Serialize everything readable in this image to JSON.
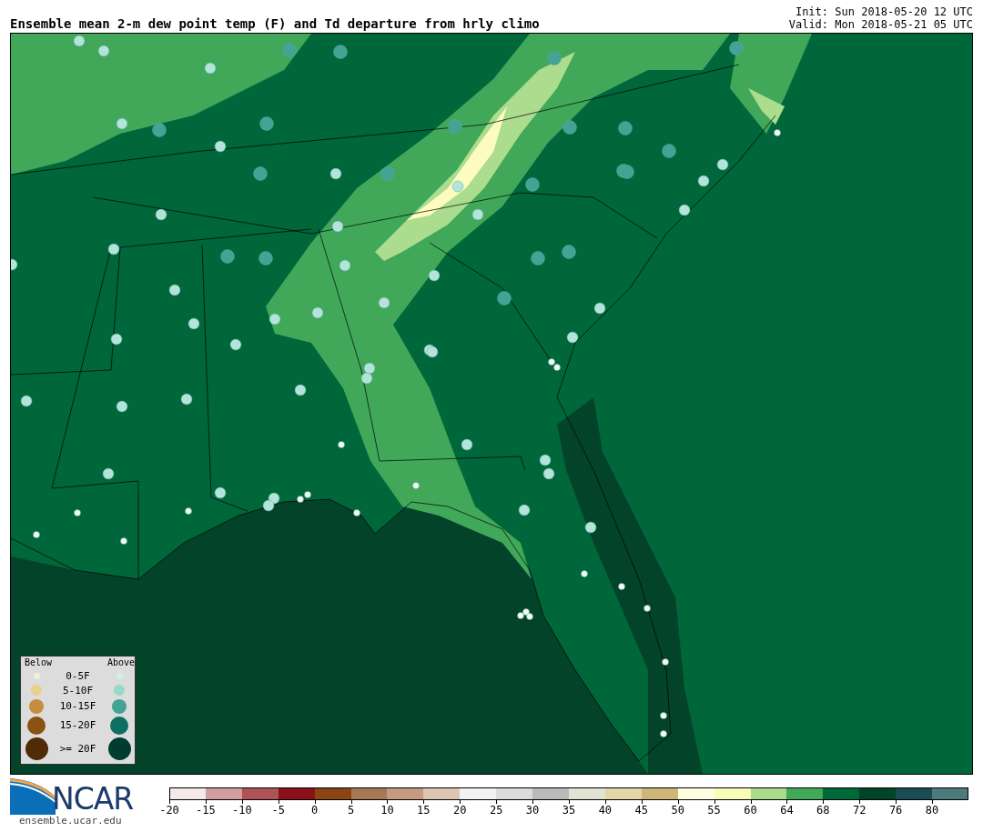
{
  "header": {
    "title": "Ensemble mean 2-m dew point temp (F) and Td departure from hrly climo",
    "init": "Init: Sun 2018-05-20 12 UTC",
    "valid": "Valid: Mon 2018-05-21 05 UTC"
  },
  "legend": {
    "below_label": "Below",
    "above_label": "Above",
    "rows": [
      {
        "label": "0-5F",
        "below": {
          "color": "#f5ecd5"
        },
        "above": {
          "color": "#d4efe9"
        }
      },
      {
        "label": "5-10F",
        "below": {
          "color": "#e8d08d"
        },
        "above": {
          "color": "#96d9c8"
        }
      },
      {
        "label": "10-15F",
        "below": {
          "color": "#c68c3f"
        },
        "above": {
          "color": "#43a394"
        }
      },
      {
        "label": "15-20F",
        "below": {
          "color": "#8b5211"
        },
        "above": {
          "color": "#0d6e62"
        }
      },
      {
        "label": ">= 20F",
        "below": {
          "color": "#4f2b07"
        },
        "above": {
          "color": "#003d30"
        }
      }
    ]
  },
  "footer": {
    "logo_text": "NCAR",
    "url": "ensemble.ucar.edu"
  },
  "colorbar": {
    "segments": [
      {
        "color": "#f5e9e9",
        "tick": "-20"
      },
      {
        "color": "#d09da0",
        "tick": "-15"
      },
      {
        "color": "#ad5355",
        "tick": "-10"
      },
      {
        "color": "#8b1019",
        "tick": "-5"
      },
      {
        "color": "#8b4513",
        "tick": "0"
      },
      {
        "color": "#a77855",
        "tick": "5"
      },
      {
        "color": "#c49a80",
        "tick": "10"
      },
      {
        "color": "#dcc5b3",
        "tick": "15"
      },
      {
        "color": "#f2f2f2",
        "tick": "20"
      },
      {
        "color": "#dcdcdc",
        "tick": "25"
      },
      {
        "color": "#bababa",
        "tick": "30"
      },
      {
        "color": "#e0e2d2",
        "tick": "35"
      },
      {
        "color": "#e3d6a9",
        "tick": "40"
      },
      {
        "color": "#cdb677",
        "tick": "45"
      },
      {
        "color": "#fffde0",
        "tick": "50"
      },
      {
        "color": "#f7fdb7",
        "tick": "55"
      },
      {
        "color": "#a8db8d",
        "tick": "60"
      },
      {
        "color": "#41a85a",
        "tick": "64"
      },
      {
        "color": "#006838",
        "tick": "68"
      },
      {
        "color": "#03432a",
        "tick": "72"
      },
      {
        "color": "#1a4d53",
        "tick": "76"
      },
      {
        "color": "#4d7b7c",
        "tick": "80"
      }
    ]
  }
}
